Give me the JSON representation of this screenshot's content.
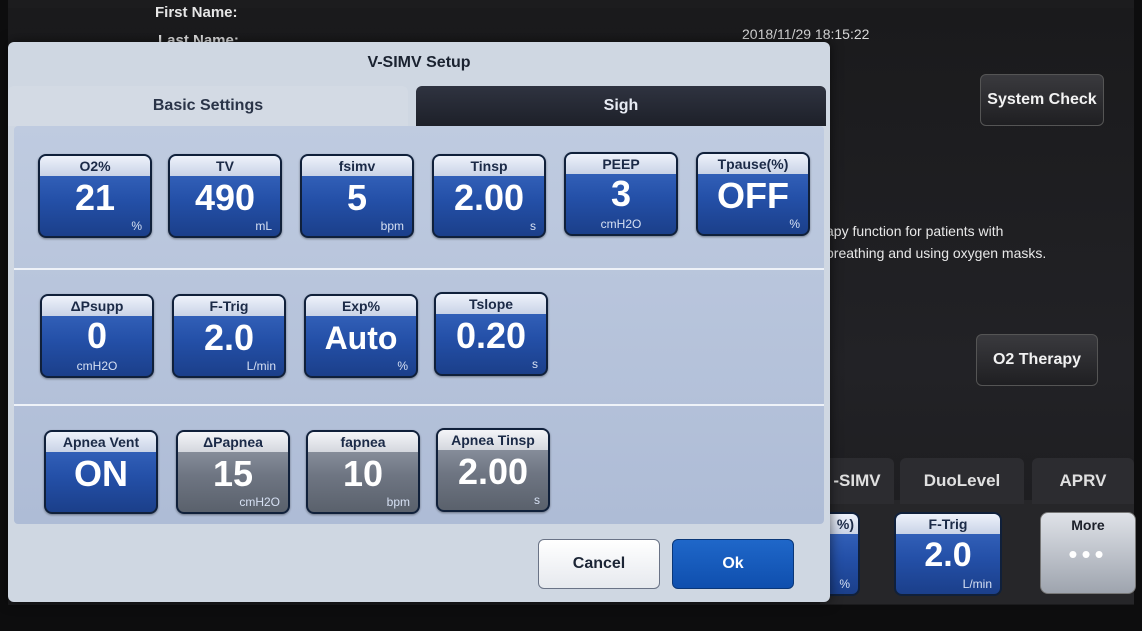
{
  "patient": {
    "first_name_label": "First Name:",
    "last_name_label": "Last Name:"
  },
  "datetime": "2018/11/29 18:15:22",
  "side": {
    "system_check": "System Check",
    "description_line1": "apy function for patients with",
    "description_line2": "breathing and using oxygen masks.",
    "o2_therapy": "O2 Therapy"
  },
  "modes": {
    "tab1": "-SIMV",
    "tab2": "DuoLevel",
    "tab3": "APRV"
  },
  "bottom_params": [
    {
      "label": "%)",
      "value": "",
      "unit": "%"
    },
    {
      "label": "F-Trig",
      "value": "2.0",
      "unit": "L/min"
    }
  ],
  "more": {
    "label": "More",
    "dots": "•••"
  },
  "dialog": {
    "title": "V-SIMV Setup",
    "tabs": {
      "basic": "Basic Settings",
      "sigh": "Sigh"
    },
    "row1": [
      {
        "label": "O2%",
        "value": "21",
        "unit": "%"
      },
      {
        "label": "TV",
        "value": "490",
        "unit": "mL"
      },
      {
        "label": "fsimv",
        "value": "5",
        "unit": "bpm"
      },
      {
        "label": "Tinsp",
        "value": "2.00",
        "unit": "s"
      },
      {
        "label": "PEEP",
        "value": "3",
        "unit": "cmH2O"
      },
      {
        "label": "Tpause(%)",
        "value": "OFF",
        "unit": "%"
      }
    ],
    "row2": [
      {
        "label": "ΔPsupp",
        "value": "0",
        "unit": "cmH2O"
      },
      {
        "label": "F-Trig",
        "value": "2.0",
        "unit": "L/min"
      },
      {
        "label": "Exp%",
        "value": "Auto",
        "unit": "%"
      },
      {
        "label": "Tslope",
        "value": "0.20",
        "unit": "s"
      }
    ],
    "row3": [
      {
        "label": "Apnea Vent",
        "value": "ON",
        "unit": ""
      },
      {
        "label": "ΔPapnea",
        "value": "15",
        "unit": "cmH2O"
      },
      {
        "label": "fapnea",
        "value": "10",
        "unit": "bpm"
      },
      {
        "label": "Apnea Tinsp",
        "value": "2.00",
        "unit": "s"
      }
    ],
    "cancel": "Cancel",
    "ok": "Ok"
  }
}
